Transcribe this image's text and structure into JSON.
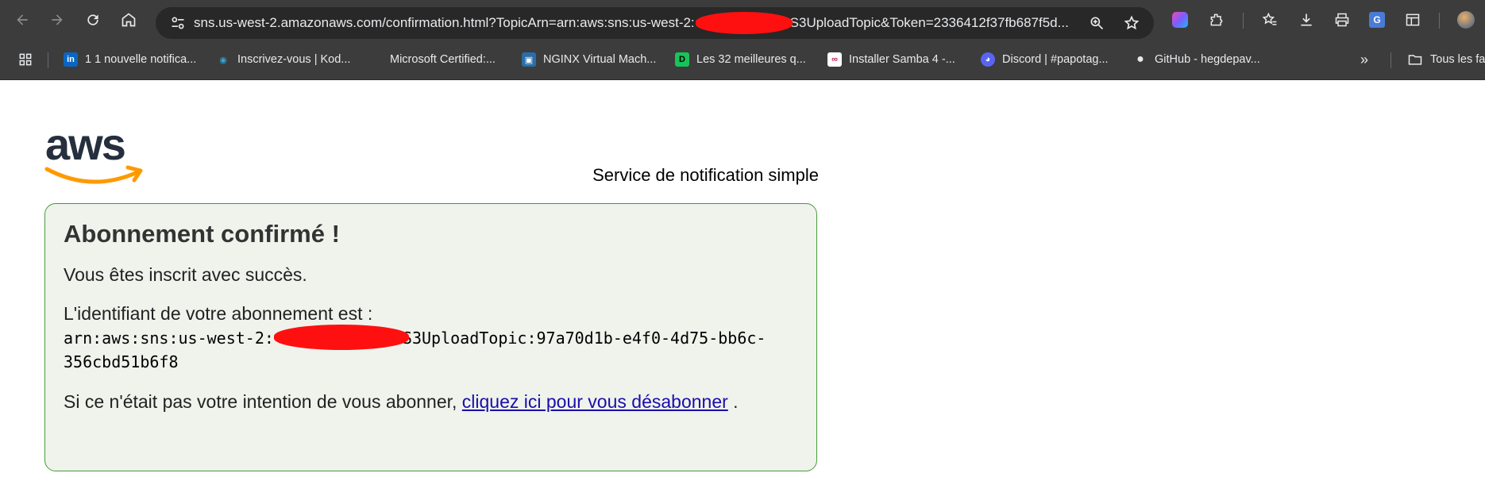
{
  "browser": {
    "url": "sns.us-west-2.amazonaws.com/confirmation.html?TopicArn=arn:aws:sns:us-west-2:",
    "url_tail": "S3UploadTopic&Token=2336412f37fb687f5d...",
    "bookmarks": [
      {
        "label": "1 1 nouvelle notifica...",
        "icon": "linkedin-icon",
        "color": "#0a66c2",
        "glyph": "in"
      },
      {
        "label": "Inscrivez-vous | Kod...",
        "icon": "eye-icon",
        "color": "#29a8df",
        "glyph": "◉"
      },
      {
        "label": "Microsoft Certified:...",
        "icon": "microsoft-icon",
        "color": "#f25022",
        "glyph": ""
      },
      {
        "label": "NGINX Virtual Mach...",
        "icon": "nginx-icon",
        "color": "#2a6ea8",
        "glyph": "▣"
      },
      {
        "label": "Les 32 meilleures q...",
        "icon": "dc-icon",
        "color": "#19c35a",
        "glyph": "D"
      },
      {
        "label": "Installer Samba 4 -...",
        "icon": "infinity-icon",
        "color": "#ffffff",
        "glyph": "∞"
      },
      {
        "label": "Discord | #papotag...",
        "icon": "discord-icon",
        "color": "#5865f2",
        "glyph": "◕"
      },
      {
        "label": "GitHub - hegdepav...",
        "icon": "github-icon",
        "color": "#3c3c3c",
        "glyph": "●"
      }
    ],
    "other_bookmarks": "Tous les fa"
  },
  "page": {
    "service_title": "Service de notification simple",
    "heading": "Abonnement confirmé !",
    "success_text": "Vous êtes inscrit avec succès.",
    "id_label": "L'identifiant de votre abonnement est :",
    "arn_prefix": "arn:aws:sns:us-west-2:",
    "arn_suffix": "S3UploadTopic:97a70d1b-e4f0-4d75-bb6c-",
    "arn_line2": "356cbd51b6f8",
    "unsubscribe_prefix": "Si ce n'était pas votre intention de vous abonner, ",
    "unsubscribe_link": "cliquez ici pour vous désabonner",
    "unsubscribe_suffix": " ."
  },
  "colors": {
    "chrome_bg": "#3c3c3c",
    "box_border": "#4a9a3a",
    "box_bg": "#eff3ec",
    "aws_orange": "#ff9900",
    "aws_navy": "#252f3e",
    "link": "#1a0dab"
  }
}
